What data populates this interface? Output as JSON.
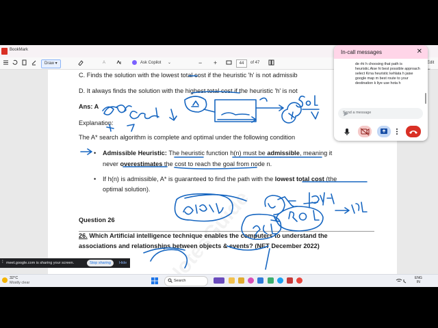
{
  "browser": {
    "tab_title": "BookMark",
    "toolbar": {
      "draw_label": "Draw",
      "copilot_label": "Ask Copilot",
      "page_current": "44",
      "page_total": "of 47",
      "edit_label": "Edit w"
    }
  },
  "document": {
    "option_c": "C. Finds the solution with the lowest total cost if the heuristic 'h' is not admissib",
    "option_d": "D. It always finds the solution with the highest total cost if the heuristic 'h' is not",
    "ans": "Ans: A",
    "explanation": "Explanation:",
    "para": "The A* search algorithm is complete and optimal under the following condition",
    "bullet1_head": "Admissible Heuristic:",
    "bullet1_a": "The heuristic function h(n) must be",
    "bullet1_b": "admissible",
    "bullet1_c": ", meaning it",
    "bullet1_line2a": "never",
    "bullet1_line2b": "overestimates",
    "bullet1_line2c": "the cost to reach the goal from node n.",
    "bullet2_a": "If h(n) is admissible, A* is guaranteed to find the path with the",
    "bullet2_b": "lowest total cost",
    "bullet2_c": "(the",
    "bullet2_line2": "optimal solution).",
    "question_heading": "Question 26",
    "q26_a": "26.",
    "q26_b": "Which Artificial intelligence technique enables the computers to understand the",
    "q26_line2a": "associations and relationships between objects & events?",
    "q26_line2b": "(NET December 2022)"
  },
  "call_panel": {
    "title": "In-call messages",
    "message": "de rhi h choosing that path is heuristic.Aise hi best possible approach select Krna heuristic kehlata h jaise google map m best route to your destination k liye use hota h",
    "input_placeholder": "Send a message"
  },
  "share_bar": {
    "message": "meet.google.com is sharing your screen.",
    "stop_label": "Stop sharing",
    "hide_label": "Hide"
  },
  "taskbar": {
    "temperature": "32°C",
    "weather": "Mostly clear",
    "search_label": "Search",
    "lang_line1": "ENG",
    "lang_line2": "IN"
  },
  "colors": {
    "ink": "#1565c0",
    "tab_bg": "#f7f2f5",
    "call_header": "#ffd5e8",
    "hangup": "#d93025"
  }
}
